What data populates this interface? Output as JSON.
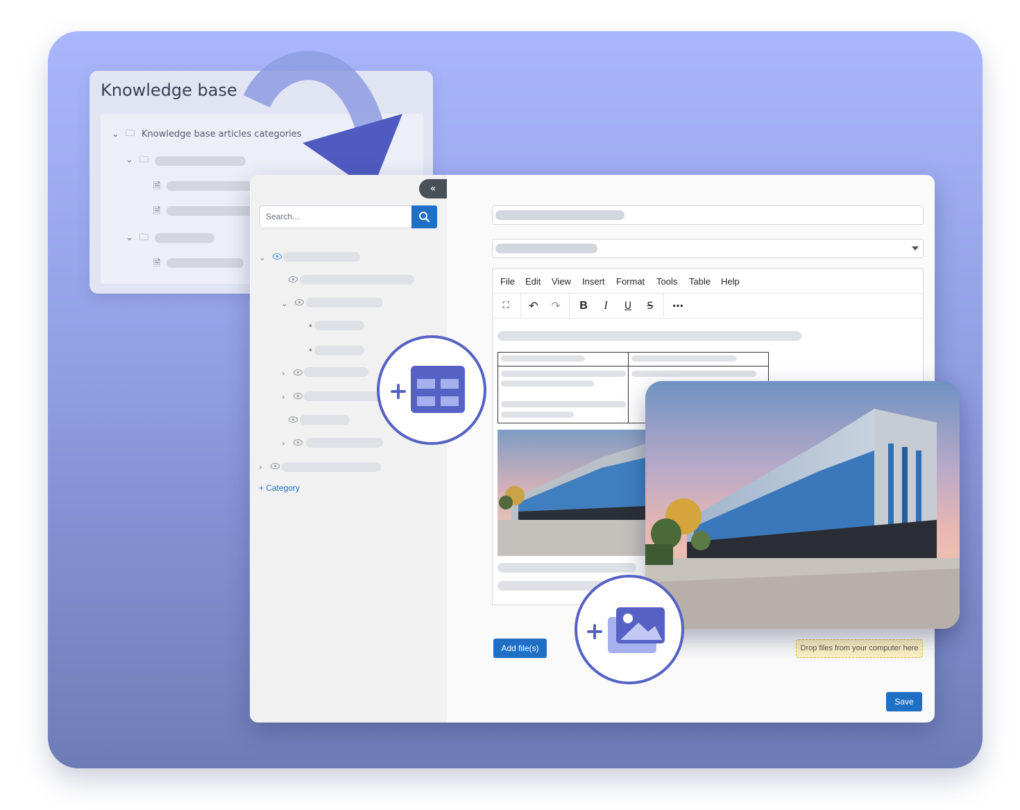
{
  "knowledge_base": {
    "title": "Knowledge base",
    "root_label": "Knowledge base articles categories"
  },
  "sidebar": {
    "collapse_label": "«",
    "search_placeholder": "Search...",
    "add_category_label": "+ Category"
  },
  "editor": {
    "menu": [
      "File",
      "Edit",
      "View",
      "Insert",
      "Format",
      "Tools",
      "Table",
      "Help"
    ],
    "toolbar_icons": [
      "fullscreen-icon",
      "undo-icon",
      "redo-icon",
      "bold-icon",
      "italic-icon",
      "underline-icon",
      "strikethrough-icon",
      "more-icon"
    ]
  },
  "actions": {
    "add_files_label": "Add file(s)",
    "drop_zone_label": "Drop files from your computer here",
    "save_label": "Save"
  },
  "colors": {
    "accent": "#1f6fc5",
    "badge": "#5562c4",
    "background_top": "#a9b6fb",
    "background_bottom": "#6e7cb6"
  }
}
